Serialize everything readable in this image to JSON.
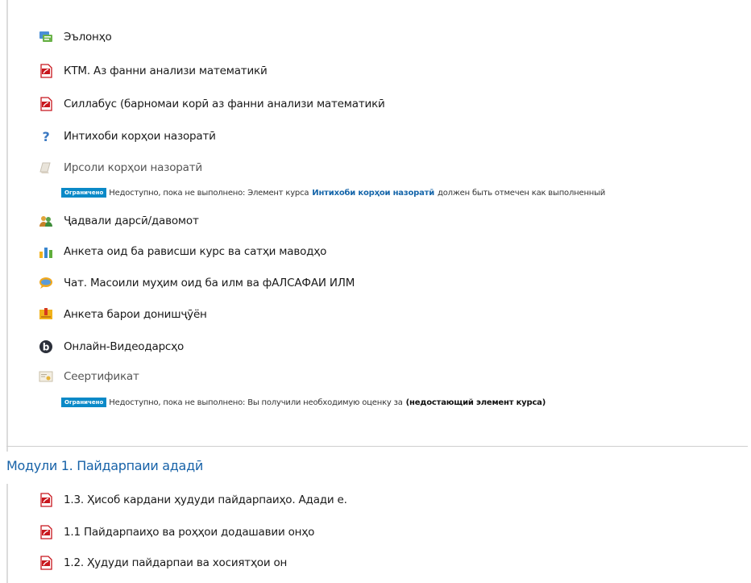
{
  "activities": [
    {
      "label": "Эълонҳо",
      "icon": "forum-icon"
    },
    {
      "label": "КТМ. Аз фанни анализи математикӣ",
      "icon": "pdf-icon"
    },
    {
      "label": "Силлабус (барномаи корӣ аз фанни анализи математикӣ",
      "icon": "pdf-icon"
    },
    {
      "label": "Интихоби корҳои назоратӣ",
      "icon": "question-icon"
    },
    {
      "label": "Ирсоли корҳои назоратӣ",
      "icon": "assignment-icon"
    },
    {
      "label": "Ҷадвали дарсӣ/давомот",
      "icon": "attendance-icon"
    },
    {
      "label": "Анкета оид ба рависши курс ва сатҳи маводҳо",
      "icon": "chart-icon"
    },
    {
      "label": "Чат. Масоили муҳим оид ба илм ва фАЛСАФАИ ИЛМ",
      "icon": "chat-icon"
    },
    {
      "label": "Анкета барои донишҷӯён",
      "icon": "feedback-icon"
    },
    {
      "label": "Онлайн-Видеодарсҳо",
      "icon": "bigbluebutton-icon"
    },
    {
      "label": "Сеертификат",
      "icon": "certificate-icon"
    }
  ],
  "restriction1": {
    "badge": "Ограничено",
    "prefix": "Недоступно, пока не выполнено: Элемент курса",
    "link": "Интихоби корҳои назоратӣ",
    "suffix": "должен быть отмечен как выполненный"
  },
  "restriction2": {
    "badge": "Ограничено",
    "prefix": "Недоступно, пока не выполнено: Вы получили необходимую оценку за",
    "bold": "(недостающий элемент курса)"
  },
  "section": {
    "title": "Модули 1. Пайдарпаии ададӣ",
    "items": [
      {
        "label": "1.3. Ҳисоб кардани ҳудуди пайдарпаиҳо. Адади e.",
        "icon": "pdf-icon"
      },
      {
        "label": "1.1 Пайдарпаиҳо ва роҳҳои додашавии онҳо",
        "icon": "pdf-icon"
      },
      {
        "label": "1.2. Ҳудуди пайдарпаи ва хосиятҳои он",
        "icon": "pdf-icon"
      }
    ]
  },
  "colors": {
    "link": "#1666aa",
    "badge": "#0a89c7",
    "section_title": "#1762a8",
    "pdf_red": "#c8161d"
  }
}
